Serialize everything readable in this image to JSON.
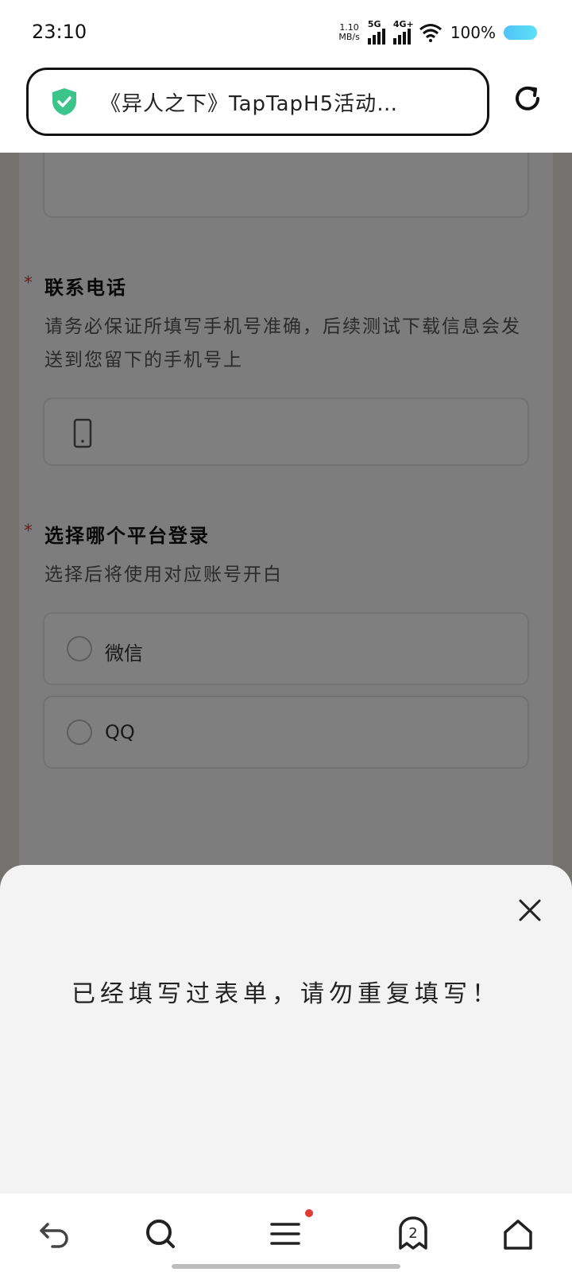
{
  "status_bar": {
    "time": "23:10",
    "net_speed_value": "1.10",
    "net_speed_unit": "MB/s",
    "signal_1_label": "5G",
    "signal_2_label": "4G+",
    "battery_text": "100%",
    "battery_color": "#4fc3f7"
  },
  "address_bar": {
    "title": "《异人之下》TapTapH5活动…",
    "security_icon": "shield-check-icon",
    "reload_icon": "reload-icon",
    "shield_color": "#3cc48a"
  },
  "form": {
    "phone_field": {
      "required_mark": "*",
      "title": "联系电话",
      "description": "请务必保证所填写手机号准确，后续测试下载信息会发送到您留下的手机号上",
      "icon": "phone-icon"
    },
    "platform_field": {
      "required_mark": "*",
      "title": "选择哪个平台登录",
      "description": "选择后将使用对应账号开白",
      "options": [
        {
          "label": "微信"
        },
        {
          "label": "QQ"
        }
      ]
    }
  },
  "sheet": {
    "message": "已经填写过表单，请勿重复填写！",
    "close_icon": "close-icon"
  },
  "bottom_nav": {
    "items": [
      "back-icon",
      "search-icon",
      "menu-icon",
      "tabs-icon",
      "home-icon"
    ],
    "tab_count": "2",
    "menu_badge_color": "#e53935"
  }
}
